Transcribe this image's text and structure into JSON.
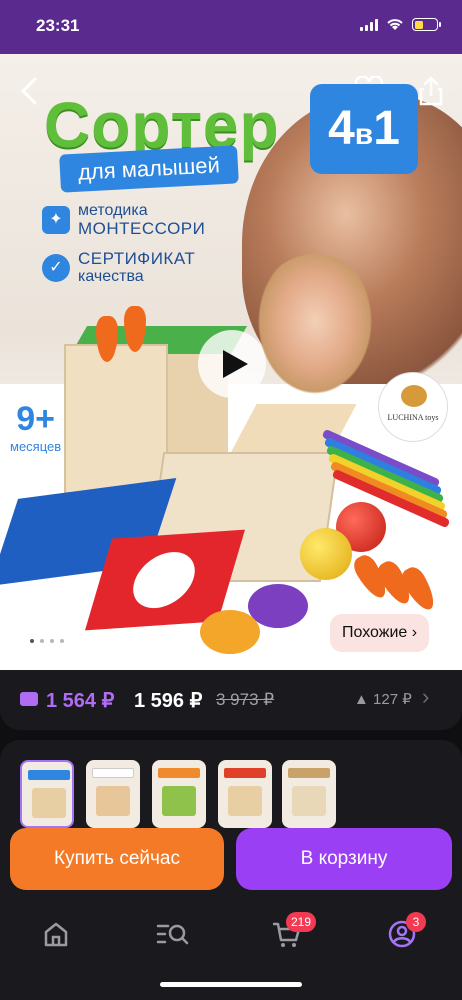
{
  "status": {
    "time": "23:31"
  },
  "hero": {
    "title": "Сортер",
    "subtitle": "для малышей",
    "badge_main": "4",
    "badge_small": "в",
    "badge_end": "1",
    "features": [
      {
        "line1": "методика",
        "line2": "МОНТЕССОРИ"
      },
      {
        "line1": "СЕРТИФИКАТ",
        "line2": "качества"
      }
    ],
    "age_num": "9+",
    "age_label": "месяцев",
    "logo_text": "LUCHINA toys",
    "similar_label": "Похожие ›"
  },
  "price": {
    "wallet_price": "1 564 ₽",
    "price": "1 596 ₽",
    "old_price": "3 973 ₽",
    "rating": "▲ 127 ₽"
  },
  "actions": {
    "buy_now": "Купить сейчас",
    "add_to_cart": "В корзину"
  },
  "tabs": {
    "cart_badge": "219",
    "profile_badge": "3"
  },
  "colors": {
    "accent_purple": "#9b3ff5",
    "accent_orange": "#f47a27",
    "status_bar": "#5b2a8f"
  }
}
